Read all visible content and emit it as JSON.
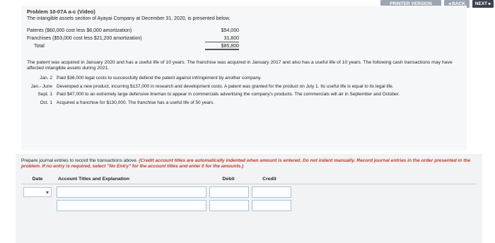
{
  "topbar": {
    "printer_label": "PRINTER VERSION",
    "back_label": "◂ BACK",
    "next_label": "NEXT ▸"
  },
  "problem": {
    "title": "Problem 10-07A a-c (Video)",
    "intro": "The intangible assets section of Ayayai Company at December 31, 2020, is presented below.",
    "assets": [
      {
        "label": "Patents ($60,000 cost less $6,000 amortization)",
        "amount": "$54,000"
      },
      {
        "label": "Franchises ($53,000 cost less $21,200 amortization)",
        "amount": "31,800"
      },
      {
        "label": "Total",
        "amount": "$85,800"
      }
    ],
    "paragraph": "The patent was acquired in January 2020 and has a useful life of 10 years. The franchise was acquired in January 2017 and also has a useful life of 10 years. The following cash transactions may have affected intangible assets during 2021.",
    "events": [
      {
        "date": "Jan. 2",
        "text": "Paid $36,000 legal costs to successfully defend the patent against infringement by another company."
      },
      {
        "date": "Jan.- June",
        "text": "Developed a new product, incurring $137,000 in research and development costs. A patent was granted for the product on July 1. Its useful life is equal to its legal life."
      },
      {
        "date": "Sept. 1",
        "text": "Paid $47,000 to an extremely large defensive lineman to appear in commercials advertising the company's products. The commercials will air in September and October."
      },
      {
        "date": "Oct. 1",
        "text": "Acquired a franchise for $130,000. The franchise has a useful life of 50 years."
      }
    ]
  },
  "instructions": {
    "main": "Prepare journal entries to record the transactions above.",
    "emphasis": "(Credit account titles are automatically indented when amount is entered. Do not indent manually. Record journal entries in the order presented in the problem. If no entry is required, select \"No Entry\" for the account titles and enter 0 for the amounts.)"
  },
  "journal": {
    "headers": {
      "date": "Date",
      "account": "Account Titles and Explanation",
      "debit": "Debit",
      "credit": "Credit"
    },
    "date_dropdown_icon": "chevron-down-icon"
  }
}
